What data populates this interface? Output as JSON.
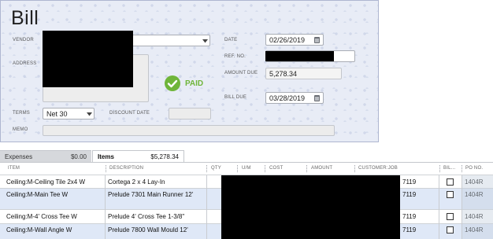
{
  "form": {
    "title": "Bill",
    "vendor_label": "VENDOR",
    "address_label": "ADDRESS",
    "terms_label": "TERMS",
    "terms_value": "Net 30",
    "discount_date_label": "DISCOUNT DATE",
    "discount_date_value": "",
    "memo_label": "MEMO",
    "memo_value": "",
    "date_label": "DATE",
    "date_value": "02/26/2019",
    "ref_no_label": "REF. NO.",
    "amount_due_label": "AMOUNT DUE",
    "amount_due_value": "5,278.34",
    "bill_due_label": "BILL DUE",
    "bill_due_value": "03/28/2019",
    "paid_label": "PAID"
  },
  "tabs": [
    {
      "label": "Expenses",
      "amount": "$0.00"
    },
    {
      "label": "Items",
      "amount": "$5,278.34"
    }
  ],
  "grid": {
    "headers": [
      "ITEM",
      "DESCRIPTION",
      "QTY",
      "U/M",
      "COST",
      "AMOUNT",
      "CUSTOMER:JOB",
      "BIL...",
      "PO NO."
    ],
    "rows": [
      {
        "item": "Ceiling:M-Ceiling Tile 2x4 W",
        "description": "Cortega 2 x 4 Lay-In",
        "customer_job": "7119",
        "po_no": "1404R"
      },
      {
        "item": "Ceiling:M-Main Tee W",
        "description": "Prelude 7301 Main Runner 12'",
        "customer_job": "7119",
        "po_no": "1404R"
      },
      {
        "item": "Ceiling:M-4' Cross Tee W",
        "description": "Prelude 4' Cross Tee 1-3/8\"",
        "customer_job": "7119",
        "po_no": "1404R"
      },
      {
        "item": "Ceiling:M-Wall Angle W",
        "description": "Prelude 7800 Wall Mould 12'",
        "customer_job": "7119",
        "po_no": "1404R"
      }
    ]
  },
  "colors": {
    "panel_bg": "#e8ecf6",
    "paid_green": "#6fb53a",
    "row_alt": "#dfe8f7"
  },
  "icons": [
    "dropdown-arrow-icon",
    "calendar-icon",
    "paid-check-icon",
    "checkbox-icon"
  ]
}
